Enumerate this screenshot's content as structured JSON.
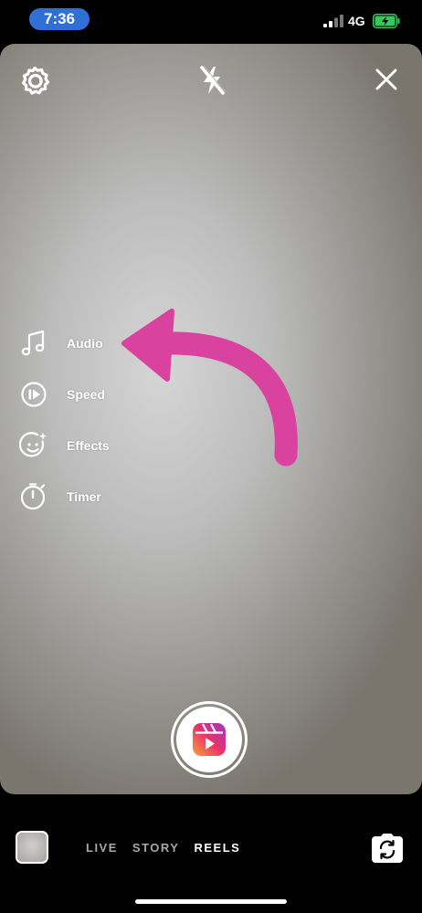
{
  "status_bar": {
    "time": "7:36",
    "network": "4G",
    "time_pill_color": "#2f6fd6",
    "battery_color": "#34c759",
    "battery_level": 0.9
  },
  "camera": {
    "settings_icon": "gear-icon",
    "flash_icon": "flash-off-icon",
    "close_icon": "close-icon"
  },
  "tools": [
    {
      "label": "Audio",
      "icon": "music-note-icon"
    },
    {
      "label": "Speed",
      "icon": "speed-icon"
    },
    {
      "label": "Effects",
      "icon": "effects-icon"
    },
    {
      "label": "Timer",
      "icon": "timer-icon"
    }
  ],
  "annotation": {
    "arrow_color": "#d9439f"
  },
  "shutter": {
    "icon": "reels-icon"
  },
  "modes": {
    "live": "LIVE",
    "story": "STORY",
    "reels": "REELS",
    "active": "REELS"
  }
}
